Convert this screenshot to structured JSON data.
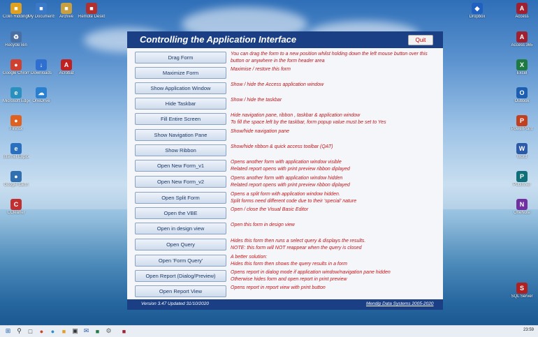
{
  "window": {
    "title": "Controlling the Application Interface",
    "quit_label": "Quit",
    "version": "Version 3.47    Updated 31/10/2020",
    "copyright": "Mendip Data Systems 2005-2020"
  },
  "rows": [
    {
      "button": "Drag Form",
      "desc": "You can drag the form to a new position whilst holding down the left mouse button over this button or anywhere in the form header area"
    },
    {
      "button": "Maximize Form",
      "desc": "Maximise / restore this form"
    },
    {
      "button": "Show Application Window",
      "desc": "Show / hide the Access application window"
    },
    {
      "button": "Hide Taskbar",
      "desc": "Show / hide the taskbar"
    },
    {
      "button": "Fill Entire Screen",
      "desc": "Hide navigation pane, ribbon , taskbar & application window\nTo fill the space left by the taskbar, form popup value must be set to Yes"
    },
    {
      "button": "Show Navigation Pane",
      "desc": "Show/hide navigation pane"
    },
    {
      "button": "Show Ribbon",
      "desc": "Show/hide ribbon & quick access toolbar (QAT)"
    },
    {
      "button": "Open New Form_v1",
      "desc": "Opens another form with application window visible\nRelated report opens with print preview ribbon diplayed"
    },
    {
      "button": "Open New Form_v2",
      "desc": "Opens another form with application window hidden\nRelated report opens with print preview ribbon diplayed"
    },
    {
      "button": "Open Split Form",
      "desc": "Opens a split form with application window hidden.\nSplit forms need different code due to their 'special' nature"
    },
    {
      "button": "Open the VBE",
      "desc": "Open / close the Visual Basic Editor"
    },
    {
      "button": "Open in design view",
      "desc": "Open this form in design view"
    },
    {
      "button": "Open Query",
      "desc": "Hides this form then runs a select query & displays the results.\nNOTE: this form will NOT reappear when the query is closed"
    },
    {
      "button": "Open 'Form Query'",
      "desc": "A better solution:\nHides this form then shows the query results in a form"
    },
    {
      "button": "Open Report (Dialog/Preview)",
      "desc": "Opens report in dialog mode if application window/navigation pane hidden\nOtherwise hides form and open report  in print preview"
    },
    {
      "button": "Open Report View",
      "desc": "Opens report in report view with print button"
    }
  ],
  "desktop_left": [
    {
      "label": "Colin Riddington",
      "color": "#e0a020"
    },
    {
      "label": "My Documents",
      "color": "#3a78c8"
    },
    {
      "label": "Archive",
      "color": "#c8a040"
    },
    {
      "label": "Remote Desktop",
      "color": "#b03030"
    },
    {
      "label": "Recycle Bin",
      "color": "#4a6fa0"
    },
    {
      "label": "Downloads",
      "color": "#2f6fd0"
    },
    {
      "label": "Google Chrome",
      "color": "#d04030"
    },
    {
      "label": "OneDrive",
      "color": "#2a80d0"
    },
    {
      "label": "Microsoft Edge",
      "color": "#2a90c0"
    },
    {
      "label": "Firefox",
      "color": "#e06020"
    },
    {
      "label": "Internet Explorer",
      "color": "#2a70c0"
    },
    {
      "label": "Google Earth",
      "color": "#3070b0"
    },
    {
      "label": "CCleaner",
      "color": "#c03030"
    },
    {
      "label": "Acrobat",
      "color": "#c02020"
    }
  ],
  "desktop_right": [
    {
      "label": "Access",
      "color": "#a02030"
    },
    {
      "label": "Access 365",
      "color": "#a02030"
    },
    {
      "label": "Excel",
      "color": "#1e7a40"
    },
    {
      "label": "Outlook",
      "color": "#1c5fb0"
    },
    {
      "label": "PowerPoint",
      "color": "#c04020"
    },
    {
      "label": "Word",
      "color": "#2a5aa8"
    },
    {
      "label": "Publisher",
      "color": "#10707a"
    },
    {
      "label": "OneNote",
      "color": "#7030a0"
    },
    {
      "label": "SQL Server",
      "color": "#b02020"
    },
    {
      "label": "Dropbox",
      "color": "#2060c0"
    }
  ],
  "taskbar": {
    "start": "start-icon",
    "clock": "23:59"
  }
}
